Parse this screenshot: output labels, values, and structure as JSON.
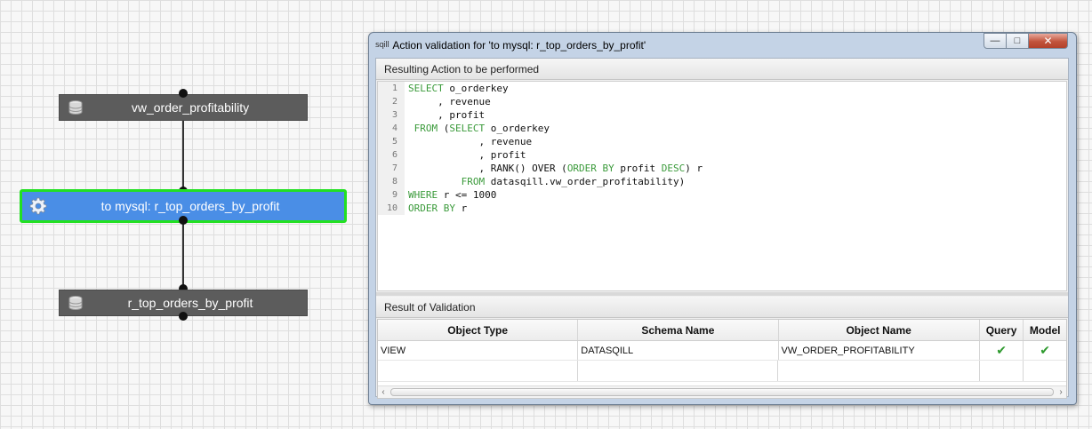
{
  "flow": {
    "source_node": {
      "label": "vw_order_profitability",
      "icon": "database-icon"
    },
    "action_node": {
      "label": "to mysql: r_top_orders_by_profit",
      "icon": "gear-icon"
    },
    "target_node": {
      "label": "r_top_orders_by_profit",
      "icon": "database-icon"
    }
  },
  "dialog": {
    "app_logo": "sqill",
    "title": "Action validation for 'to mysql: r_top_orders_by_profit'",
    "window_buttons": {
      "minimize": "—",
      "maximize": "□",
      "close": "✕"
    },
    "action_section": {
      "header": "Resulting Action to be performed",
      "code_lines": [
        "SELECT o_orderkey",
        "     , revenue",
        "     , profit",
        " FROM (SELECT o_orderkey",
        "            , revenue",
        "            , profit",
        "            , RANK() OVER (ORDER BY profit DESC) r",
        "         FROM datasqill.vw_order_profitability)",
        "WHERE r <= 1000",
        "ORDER BY r"
      ]
    },
    "validation_section": {
      "header": "Result of Validation",
      "columns": [
        "Object Type",
        "Schema Name",
        "Object Name",
        "Query",
        "Model"
      ],
      "rows": [
        {
          "object_type": "VIEW",
          "schema_name": "DATASQILL",
          "object_name": "VW_ORDER_PROFITABILITY",
          "query": "✔",
          "model": "✔"
        }
      ]
    }
  },
  "colors": {
    "action_node_fill": "#4a8ee6",
    "action_node_border": "#22e022",
    "sql_keyword": "#3a9a3a",
    "check": "#2e9a2e"
  }
}
